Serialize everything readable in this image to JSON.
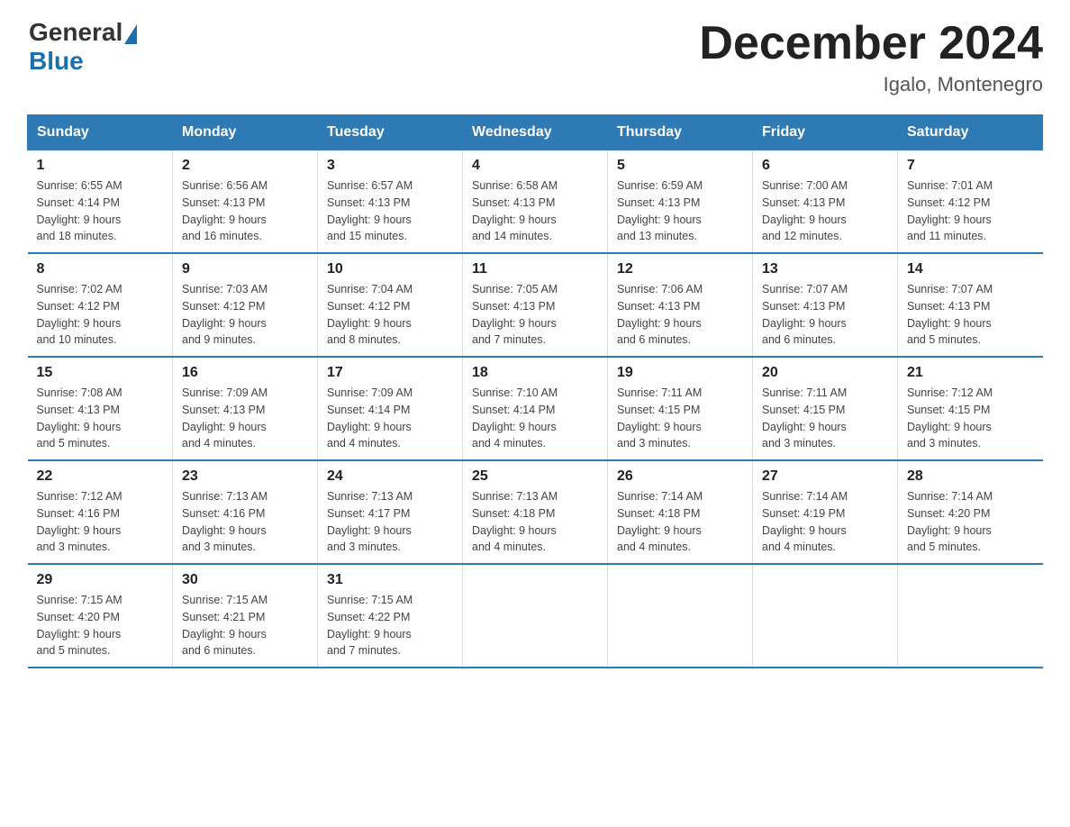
{
  "header": {
    "logo_general": "General",
    "logo_blue": "Blue",
    "month_title": "December 2024",
    "location": "Igalo, Montenegro"
  },
  "days_of_week": [
    "Sunday",
    "Monday",
    "Tuesday",
    "Wednesday",
    "Thursday",
    "Friday",
    "Saturday"
  ],
  "weeks": [
    [
      {
        "day": "1",
        "sunrise": "6:55 AM",
        "sunset": "4:14 PM",
        "daylight": "9 hours and 18 minutes."
      },
      {
        "day": "2",
        "sunrise": "6:56 AM",
        "sunset": "4:13 PM",
        "daylight": "9 hours and 16 minutes."
      },
      {
        "day": "3",
        "sunrise": "6:57 AM",
        "sunset": "4:13 PM",
        "daylight": "9 hours and 15 minutes."
      },
      {
        "day": "4",
        "sunrise": "6:58 AM",
        "sunset": "4:13 PM",
        "daylight": "9 hours and 14 minutes."
      },
      {
        "day": "5",
        "sunrise": "6:59 AM",
        "sunset": "4:13 PM",
        "daylight": "9 hours and 13 minutes."
      },
      {
        "day": "6",
        "sunrise": "7:00 AM",
        "sunset": "4:13 PM",
        "daylight": "9 hours and 12 minutes."
      },
      {
        "day": "7",
        "sunrise": "7:01 AM",
        "sunset": "4:12 PM",
        "daylight": "9 hours and 11 minutes."
      }
    ],
    [
      {
        "day": "8",
        "sunrise": "7:02 AM",
        "sunset": "4:12 PM",
        "daylight": "9 hours and 10 minutes."
      },
      {
        "day": "9",
        "sunrise": "7:03 AM",
        "sunset": "4:12 PM",
        "daylight": "9 hours and 9 minutes."
      },
      {
        "day": "10",
        "sunrise": "7:04 AM",
        "sunset": "4:12 PM",
        "daylight": "9 hours and 8 minutes."
      },
      {
        "day": "11",
        "sunrise": "7:05 AM",
        "sunset": "4:13 PM",
        "daylight": "9 hours and 7 minutes."
      },
      {
        "day": "12",
        "sunrise": "7:06 AM",
        "sunset": "4:13 PM",
        "daylight": "9 hours and 6 minutes."
      },
      {
        "day": "13",
        "sunrise": "7:07 AM",
        "sunset": "4:13 PM",
        "daylight": "9 hours and 6 minutes."
      },
      {
        "day": "14",
        "sunrise": "7:07 AM",
        "sunset": "4:13 PM",
        "daylight": "9 hours and 5 minutes."
      }
    ],
    [
      {
        "day": "15",
        "sunrise": "7:08 AM",
        "sunset": "4:13 PM",
        "daylight": "9 hours and 5 minutes."
      },
      {
        "day": "16",
        "sunrise": "7:09 AM",
        "sunset": "4:13 PM",
        "daylight": "9 hours and 4 minutes."
      },
      {
        "day": "17",
        "sunrise": "7:09 AM",
        "sunset": "4:14 PM",
        "daylight": "9 hours and 4 minutes."
      },
      {
        "day": "18",
        "sunrise": "7:10 AM",
        "sunset": "4:14 PM",
        "daylight": "9 hours and 4 minutes."
      },
      {
        "day": "19",
        "sunrise": "7:11 AM",
        "sunset": "4:15 PM",
        "daylight": "9 hours and 3 minutes."
      },
      {
        "day": "20",
        "sunrise": "7:11 AM",
        "sunset": "4:15 PM",
        "daylight": "9 hours and 3 minutes."
      },
      {
        "day": "21",
        "sunrise": "7:12 AM",
        "sunset": "4:15 PM",
        "daylight": "9 hours and 3 minutes."
      }
    ],
    [
      {
        "day": "22",
        "sunrise": "7:12 AM",
        "sunset": "4:16 PM",
        "daylight": "9 hours and 3 minutes."
      },
      {
        "day": "23",
        "sunrise": "7:13 AM",
        "sunset": "4:16 PM",
        "daylight": "9 hours and 3 minutes."
      },
      {
        "day": "24",
        "sunrise": "7:13 AM",
        "sunset": "4:17 PM",
        "daylight": "9 hours and 3 minutes."
      },
      {
        "day": "25",
        "sunrise": "7:13 AM",
        "sunset": "4:18 PM",
        "daylight": "9 hours and 4 minutes."
      },
      {
        "day": "26",
        "sunrise": "7:14 AM",
        "sunset": "4:18 PM",
        "daylight": "9 hours and 4 minutes."
      },
      {
        "day": "27",
        "sunrise": "7:14 AM",
        "sunset": "4:19 PM",
        "daylight": "9 hours and 4 minutes."
      },
      {
        "day": "28",
        "sunrise": "7:14 AM",
        "sunset": "4:20 PM",
        "daylight": "9 hours and 5 minutes."
      }
    ],
    [
      {
        "day": "29",
        "sunrise": "7:15 AM",
        "sunset": "4:20 PM",
        "daylight": "9 hours and 5 minutes."
      },
      {
        "day": "30",
        "sunrise": "7:15 AM",
        "sunset": "4:21 PM",
        "daylight": "9 hours and 6 minutes."
      },
      {
        "day": "31",
        "sunrise": "7:15 AM",
        "sunset": "4:22 PM",
        "daylight": "9 hours and 7 minutes."
      },
      null,
      null,
      null,
      null
    ]
  ]
}
